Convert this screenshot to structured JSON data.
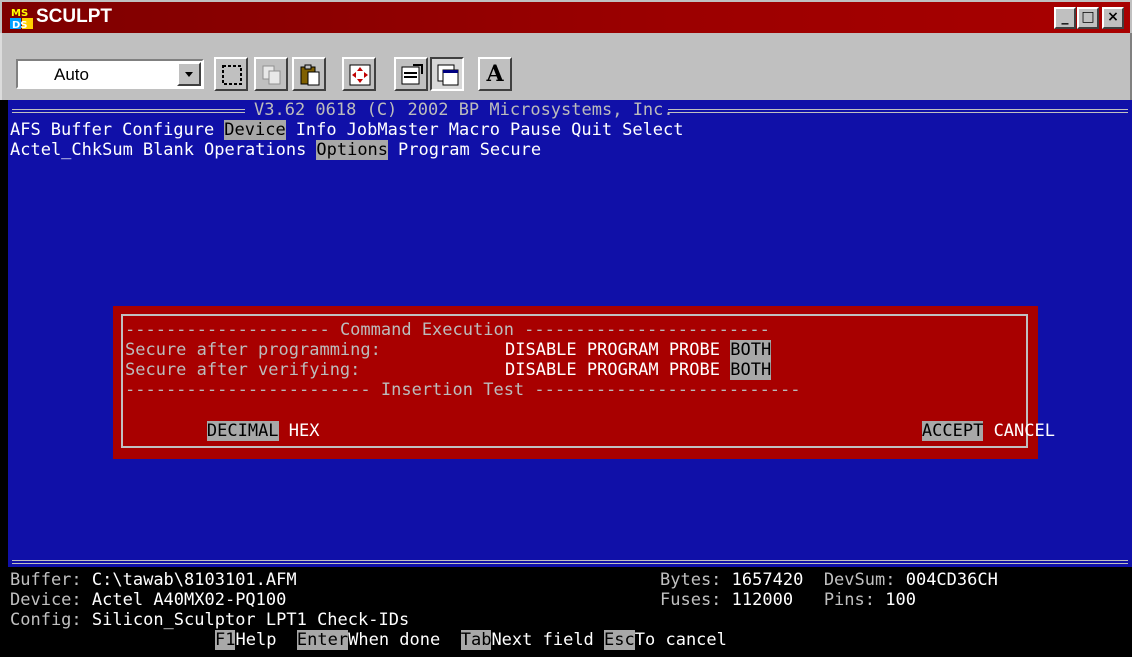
{
  "window": {
    "title": "SCULPT",
    "icon": "ms-dos-icon",
    "controls": {
      "minimize": "_",
      "maximize": "□",
      "close": "×"
    }
  },
  "toolbar": {
    "font_size": "Auto",
    "buttons": [
      "mark-icon",
      "copy-icon",
      "paste-icon",
      "fullscreen-icon",
      "properties-icon",
      "background-icon",
      "font-icon"
    ],
    "font_button": "A"
  },
  "header": {
    "version_line": "V3.62 0618 (C) 2002 BP Microsystems, Inc."
  },
  "menu": {
    "items": [
      {
        "label": "AFS",
        "selected": false
      },
      {
        "label": "Buffer",
        "selected": false
      },
      {
        "label": "Configure",
        "selected": false
      },
      {
        "label": "Device",
        "selected": true
      },
      {
        "label": "Info",
        "selected": false
      },
      {
        "label": "JobMaster",
        "selected": false
      },
      {
        "label": "Macro",
        "selected": false
      },
      {
        "label": "Pause",
        "selected": false
      },
      {
        "label": "Quit",
        "selected": false
      },
      {
        "label": "Select",
        "selected": false
      }
    ]
  },
  "submenu": {
    "items": [
      {
        "label": "Actel_ChkSum",
        "selected": false
      },
      {
        "label": "Blank",
        "selected": false
      },
      {
        "label": "Operations",
        "selected": false
      },
      {
        "label": "Options",
        "selected": true
      },
      {
        "label": "Program",
        "selected": false
      },
      {
        "label": "Secure",
        "selected": false
      }
    ]
  },
  "dialog": {
    "title": "Command Execution",
    "row1": {
      "label": "Secure after programming:",
      "options": [
        "DISABLE",
        "PROGRAM",
        "PROBE",
        "BOTH"
      ],
      "selected": "BOTH"
    },
    "row2": {
      "label": "Secure after verifying:",
      "options": [
        "DISABLE",
        "PROGRAM",
        "PROBE",
        "BOTH"
      ],
      "selected": "BOTH"
    },
    "section2_title": "Insertion Test",
    "radix": {
      "options": [
        "DECIMAL",
        "HEX"
      ],
      "selected": "DECIMAL"
    },
    "accept": "ACCEPT",
    "cancel": "CANCEL"
  },
  "status": {
    "buffer_label": "Buffer:",
    "buffer_value": "C:\\tawab\\8103101.AFM",
    "bytes_label": "Bytes:",
    "bytes_value": "1657420",
    "devsum_label": "DevSum:",
    "devsum_value": "004CD36CH",
    "device_label": "Device:",
    "device_value": "Actel A40MX02-PQ100",
    "fuses_label": "Fuses:",
    "fuses_value": "112000",
    "pins_label": "Pins:",
    "pins_value": "100",
    "config_label": "Config:",
    "config_value": "Silicon_Sculptor LPT1 Check-IDs"
  },
  "hints": [
    {
      "key": "F1",
      "text": "Help"
    },
    {
      "key": "Enter",
      "text": "When done"
    },
    {
      "key": "Tab",
      "text": "Next field"
    },
    {
      "key": "Esc",
      "text": "To cancel"
    }
  ]
}
